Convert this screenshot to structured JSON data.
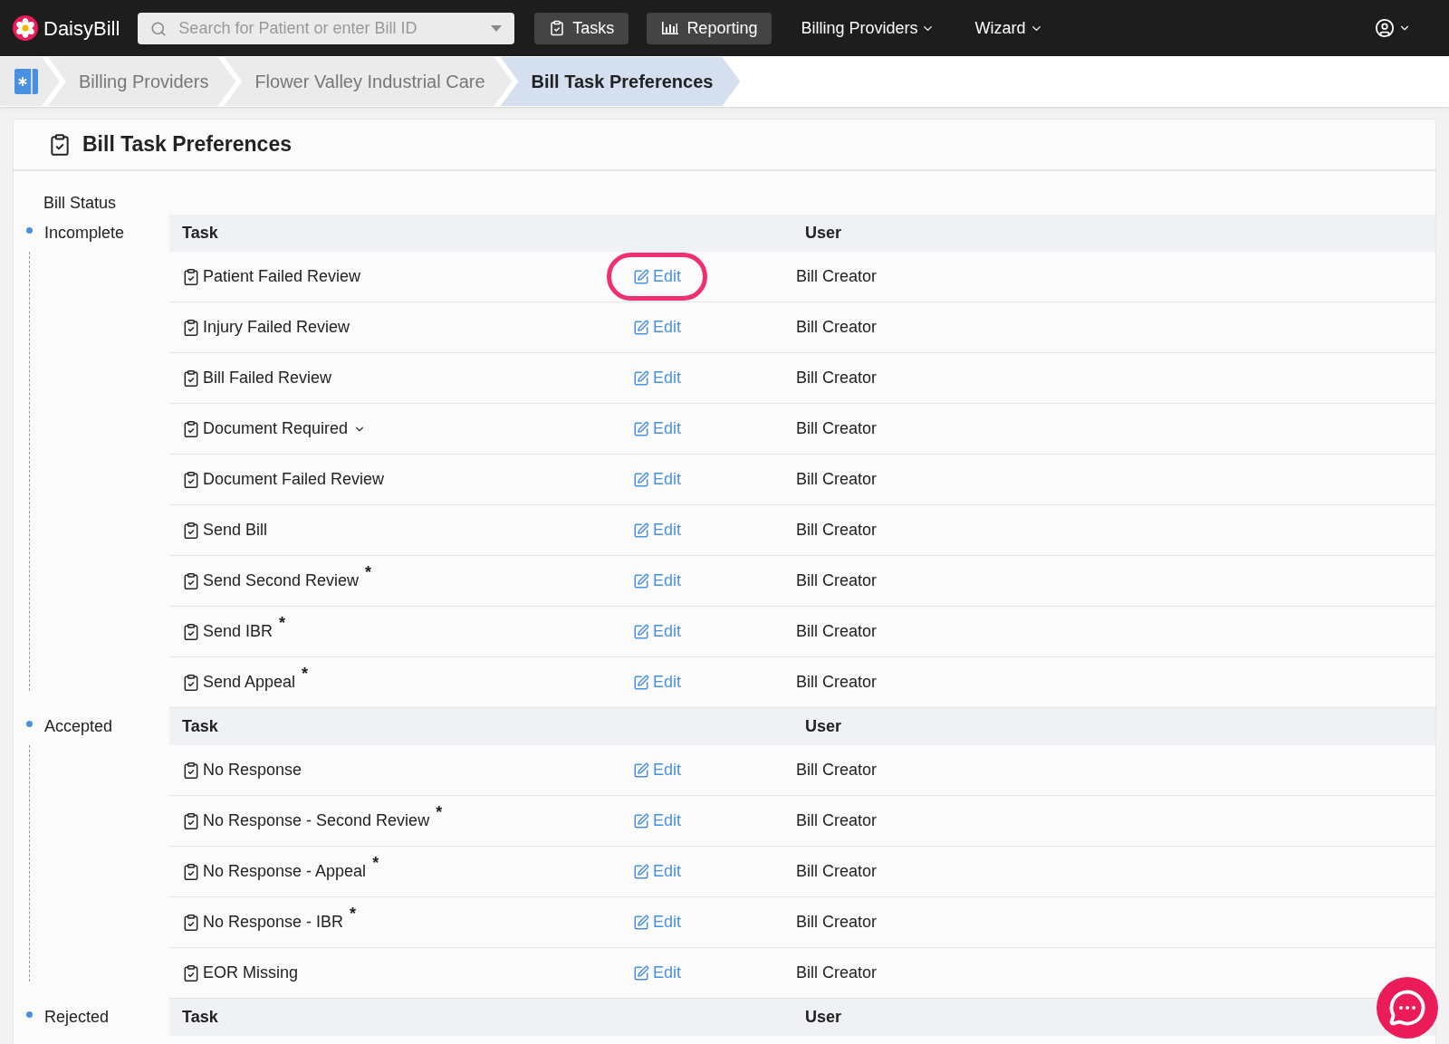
{
  "nav": {
    "logo": "DaisyBill",
    "search": {
      "placeholder": "Search for Patient or enter Bill ID"
    },
    "items": [
      {
        "kind": "button",
        "label": "Tasks"
      },
      {
        "kind": "button",
        "label": "Reporting"
      },
      {
        "kind": "menu",
        "label": "Billing Providers"
      },
      {
        "kind": "menu",
        "label": "Wizard"
      }
    ]
  },
  "breadcrumb": [
    {
      "label": "Billing Providers",
      "selected": false
    },
    {
      "label": "Flower Valley Industrial Care",
      "selected": false
    },
    {
      "label": "Bill Task Preferences",
      "selected": true
    }
  ],
  "panel": {
    "title": "Bill Task Preferences",
    "status_heading": "Bill Status",
    "sections": [
      {
        "status": "Incomplete",
        "columns": [
          "Task",
          "User"
        ],
        "rows": [
          {
            "task": "Patient Failed Review",
            "action": "Edit",
            "user": "Bill Creator",
            "highlighted": true,
            "expandable": false
          },
          {
            "task": "Injury Failed Review",
            "action": "Edit",
            "user": "Bill Creator",
            "highlighted": false,
            "expandable": false
          },
          {
            "task": "Bill Failed Review",
            "action": "Edit",
            "user": "Bill Creator",
            "highlighted": false,
            "expandable": false
          },
          {
            "task": "Document Required",
            "action": "Edit",
            "user": "Bill Creator",
            "highlighted": false,
            "expandable": true
          },
          {
            "task": "Document Failed Review",
            "action": "Edit",
            "user": "Bill Creator",
            "highlighted": false,
            "expandable": false
          },
          {
            "task": "Send Bill",
            "action": "Edit",
            "user": "Bill Creator",
            "highlighted": false,
            "expandable": false
          },
          {
            "task": "Send Second Review $^{*}$",
            "action": "Edit",
            "user": "Bill Creator",
            "highlighted": false,
            "expandable": false
          },
          {
            "task": "Send IBR $^{*}$",
            "action": "Edit",
            "user": "Bill Creator",
            "highlighted": false,
            "expandable": false
          },
          {
            "task": "Send Appeal $^{*}$",
            "action": "Edit",
            "user": "Bill Creator",
            "highlighted": false,
            "expandable": false
          }
        ]
      },
      {
        "status": "Accepted",
        "columns": [
          "Task",
          "User"
        ],
        "rows": [
          {
            "task": "No Response",
            "action": "Edit",
            "user": "Bill Creator",
            "highlighted": false,
            "expandable": false
          },
          {
            "task": "No Response - Second Review $^{*}$",
            "action": "Edit",
            "user": "Bill Creator",
            "highlighted": false,
            "expandable": false
          },
          {
            "task": "No Response - Appeal $^{*}$",
            "action": "Edit",
            "user": "Bill Creator",
            "highlighted": false,
            "expandable": false
          },
          {
            "task": "No Response - IBR $^{*}$",
            "action": "Edit",
            "user": "Bill Creator",
            "highlighted": false,
            "expandable": false
          },
          {
            "task": "EOR Missing",
            "action": "Edit",
            "user": "Bill Creator",
            "highlighted": false,
            "expandable": false
          }
        ]
      },
      {
        "status": "Rejected",
        "columns": [
          "Task",
          "User"
        ]
      }
    ]
  }
}
